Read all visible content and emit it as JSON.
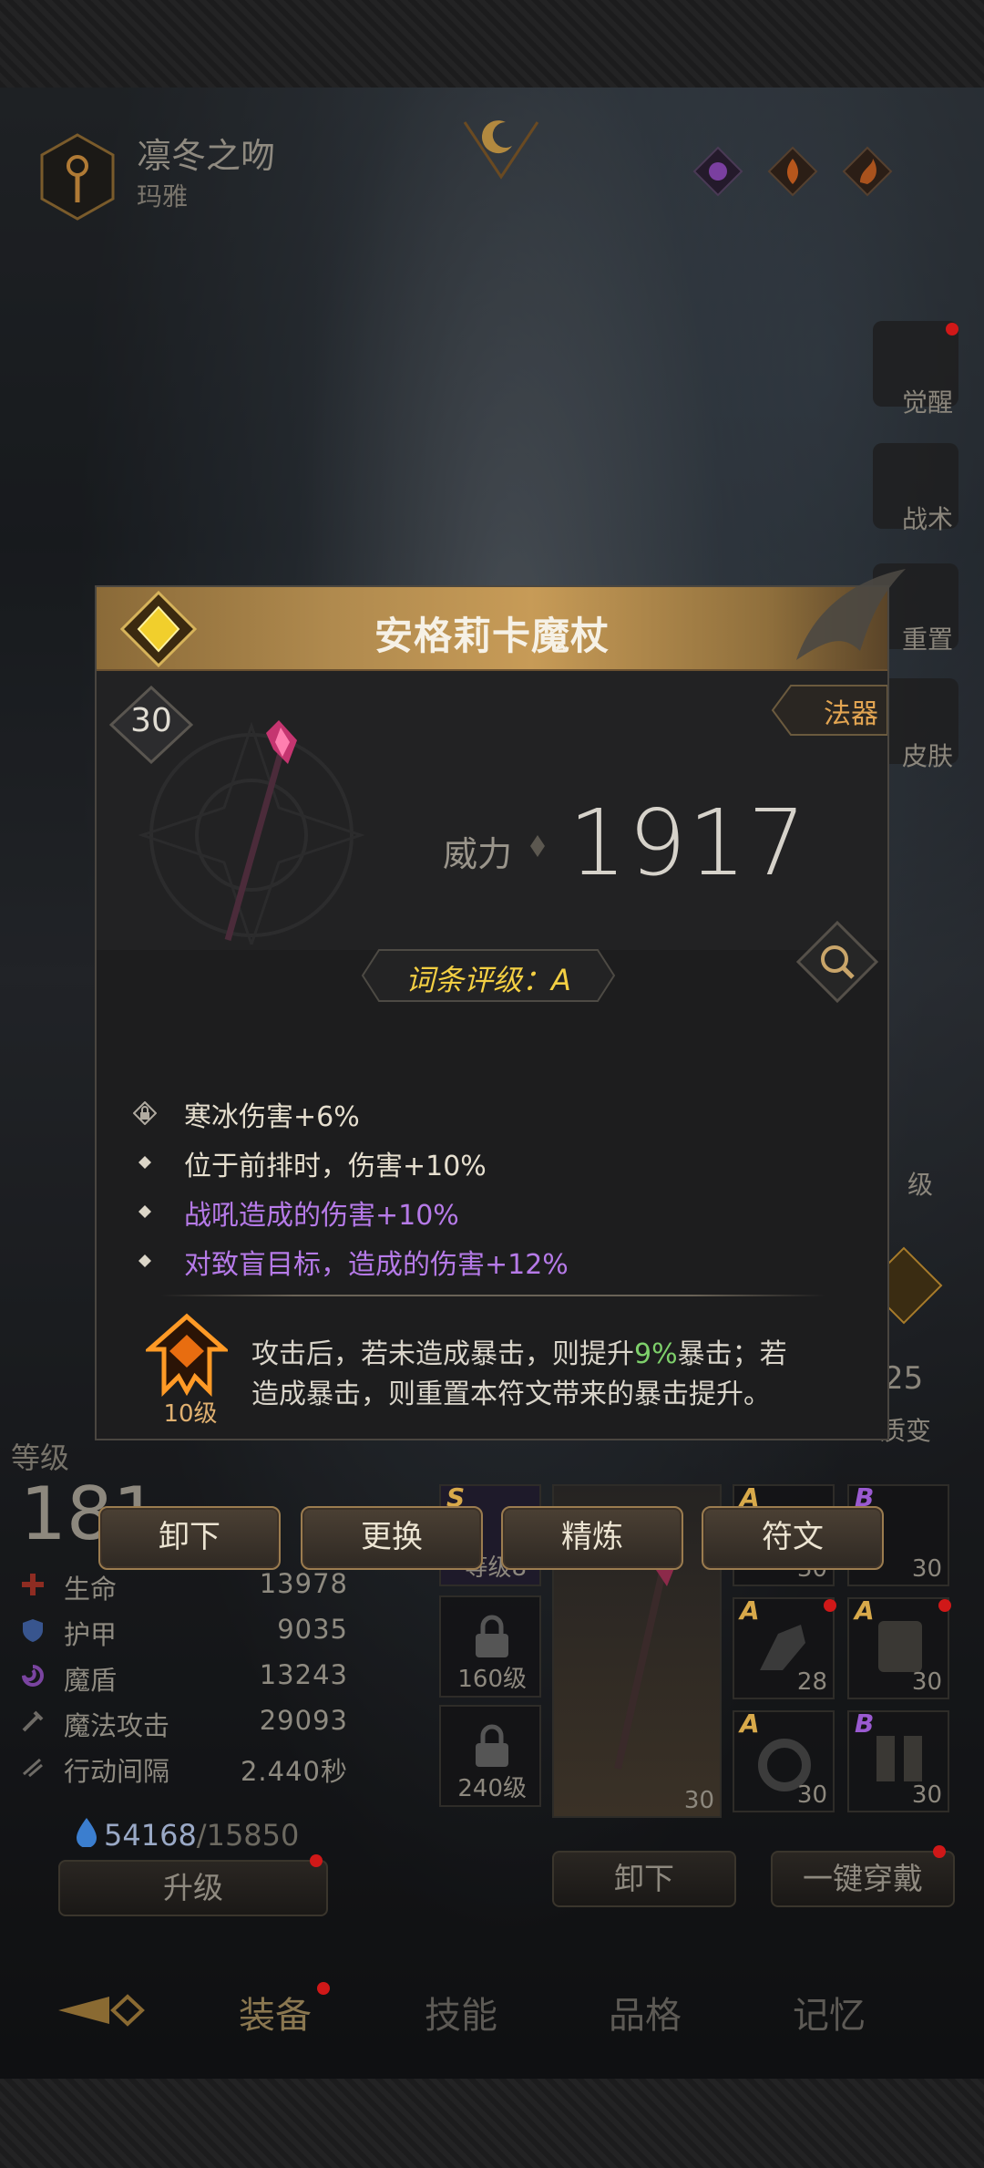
{
  "header": {
    "title": "凛冬之吻",
    "subtitle": "玛雅"
  },
  "side_menu": [
    {
      "label": "觉醒",
      "badge": true
    },
    {
      "label": "战术",
      "badge": false
    },
    {
      "label": "重置",
      "badge": false
    },
    {
      "label": "皮肤",
      "badge": false
    }
  ],
  "item_popup": {
    "name": "安格莉卡魔杖",
    "level": "30",
    "type": "法器",
    "power_label": "威力",
    "power_value": "1917",
    "affix_grade": "词条评级：A",
    "affixes": [
      {
        "text": "寒冰伤害+6%",
        "locked": true,
        "color": "#e6dfcf"
      },
      {
        "text": "位于前排时，伤害+10%",
        "locked": false,
        "color": "#e6dfcf"
      },
      {
        "text": "战吼造成的伤害+10%",
        "locked": false,
        "color": "#b67ae8"
      },
      {
        "text": "对致盲目标，造成的伤害+12%",
        "locked": false,
        "color": "#b67ae8"
      }
    ],
    "rune": {
      "level": "10级",
      "line1_pre": "攻击后，若未造成暴击，则提升",
      "line1_hl": "9%",
      "line1_post": "暴击；若",
      "line2": "造成暴击，则重置本符文带来的暴击提升。"
    },
    "actions": [
      "卸下",
      "更换",
      "精炼",
      "符文"
    ]
  },
  "hero": {
    "level_label": "等级",
    "level_value": "181",
    "stats": [
      {
        "label": "生命",
        "value": "13978",
        "icon": "heart-cross-icon",
        "color": "#c0392b"
      },
      {
        "label": "护甲",
        "value": "9035",
        "icon": "shield-icon",
        "color": "#4a77c4"
      },
      {
        "label": "魔盾",
        "value": "13243",
        "icon": "swirl-icon",
        "color": "#9b59b6"
      },
      {
        "label": "魔法攻击",
        "value": "29093",
        "icon": "magic-attack-icon",
        "color": "#8a8a8a"
      },
      {
        "label": "行动间隔",
        "value": "2.440秒",
        "icon": "speed-icon",
        "color": "#8a8a8a"
      }
    ],
    "exp_current": "54168",
    "exp_need": "/15850",
    "upgrade_label": "升级"
  },
  "rune_slots": [
    {
      "label": "等级8",
      "locked": false,
      "grade": "S"
    },
    {
      "label": "160级",
      "locked": true
    },
    {
      "label": "240级",
      "locked": true
    }
  ],
  "equipment": {
    "weapon_level": "30",
    "slots": [
      {
        "grade": "A",
        "level": "30",
        "grade_color": "#d8a94a"
      },
      {
        "grade": "B",
        "level": "30",
        "grade_color": "#9a5ad0"
      },
      {
        "grade": "A",
        "level": "28",
        "grade_color": "#d8a94a"
      },
      {
        "grade": "A",
        "level": "30",
        "grade_color": "#d8a94a"
      },
      {
        "grade": "A",
        "level": "30",
        "grade_color": "#d8a94a"
      },
      {
        "grade": "B",
        "level": "30",
        "grade_color": "#9a5ad0"
      }
    ],
    "unequip_label": "卸下",
    "equip_all_label": "一键穿戴"
  },
  "side_stats": {
    "rank_label": "级",
    "evolve_value": "25",
    "evolve_label": "质变"
  },
  "tabs": [
    "装备",
    "技能",
    "品格",
    "记忆"
  ],
  "colors": {
    "accent_gold": "#c79b57",
    "grade_yellow": "#f3cf43",
    "purple_affix": "#b67ae8",
    "highlight_green": "#7ed06b",
    "badge_red": "#d01818"
  }
}
